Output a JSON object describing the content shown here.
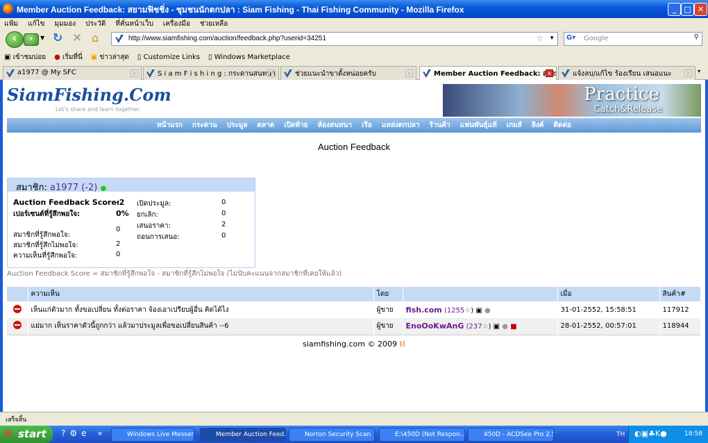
{
  "window": {
    "title": "Member Auction Feedback: สยามฟิชชิ่ง - ชุมชนนักตกปลา : Siam Fishing - Thai Fishing Community - Mozilla Firefox"
  },
  "menu": [
    "แฟ้ม",
    "แก้ไข",
    "มุมมอง",
    "ประวัติ",
    "ที่คั่นหน้าเว็บ",
    "เครื่องมือ",
    "ช่วยเหลือ"
  ],
  "nav": {
    "url": "http://www.siamfishing.com/auction/feedback.php?userid=34251",
    "search_placeholder": "Google"
  },
  "bookmarks": [
    "เข้าชมบ่อย",
    "เริ่มที่นี่",
    "ข่าวล่าสุด",
    "Customize Links",
    "Windows Marketplace"
  ],
  "tabs": [
    {
      "label": "a1977 @ My SFC"
    },
    {
      "label": "S i a m F i s h i n g : กระดานสนทนา"
    },
    {
      "label": "ช่วยแนะนำขาตั้งหน่อยครับ"
    },
    {
      "label": "Member Auction Feedback: สยาม..."
    },
    {
      "label": "แจ้งลบ/แก้ไข ร้องเรียน เสนอแนะ"
    }
  ],
  "site": {
    "logo": "SiamFishing.Com",
    "logo_tagline": "Let's share and learn together.",
    "banner_title": "Practice",
    "banner_sub": "Catch&Release",
    "nav": [
      "หน้าแรก",
      "กระดาน",
      "ประมูล",
      "ตลาด",
      "เปิดท้าย",
      "ห้องสนทนา",
      "เรือ",
      "แหล่งตกปลา",
      "ร้านค้า",
      "แฟนพันธุ์แท้",
      "เกมส์",
      "ลิงค์",
      "ติดต่อ"
    ]
  },
  "page": {
    "title": "Auction Feedback"
  },
  "member": {
    "label": "สมาชิก:",
    "name": "a1977",
    "score_paren": "(-2)",
    "score_label": "Auction Feedback Score:",
    "score": "-2",
    "percent_label": "เปอร์เซนต์ที่รู้สึกพอใจ:",
    "percent": "0%",
    "left_stats": [
      {
        "label": "สมาชิกที่รู้สึกพอใจ:",
        "value": "0"
      },
      {
        "label": "สมาชิกที่รู้สึกไม่พอใจ:",
        "value": "2"
      },
      {
        "label": "ความเห็นที่รู้สึกพอใจ:",
        "value": "0"
      }
    ],
    "right_stats": [
      {
        "label": "เปิดประมูล:",
        "value": "0"
      },
      {
        "label": "ยกเลิก:",
        "value": "0"
      },
      {
        "label": "เสนอราคา:",
        "value": "2"
      },
      {
        "label": "ถอนการเสนอ:",
        "value": "0"
      }
    ]
  },
  "formula": "Auction Feedback Score = สมาชิกที่รู้สึกพอใจ - สมาชิกที่รู้สึกไม่พอใจ (ไม่นับคะแนนจากสมาชิกที่เคยให้แล้ว)",
  "table": {
    "headers": [
      "ความเห็น",
      "โดย",
      "",
      "เมื่อ",
      "สินค้า#"
    ],
    "rows": [
      {
        "type": "negative",
        "comment": "เห็นแก่ตัวมาก ทั้งขอเปลี่ยน ทั้งต่อราคา จ้องเอาเปรียบผู้อื่น คิดได้ไง",
        "by": "ผู้ขาย",
        "user": "fish.com",
        "count": "(1255",
        "date": "31-01-2552, 15:58:51",
        "item": "117912"
      },
      {
        "type": "negative",
        "comment": "แย่มาก เห็นราคาตัวนี้ถูกกว่า แล้วมาประมูลเพื่อขอเปลี่ยนสินค้า --6",
        "by": "ผู้ขาย",
        "user": "EnoOoKwAnG",
        "count": "(237",
        "date": "28-01-2552, 00:57:01",
        "item": "118944"
      }
    ]
  },
  "footer": "siamfishing.com © 2009",
  "status": "เสร็จสิ้น",
  "taskbar": {
    "start": "start",
    "tasks": [
      "Windows Live Messen...",
      "Member Auction Feed...",
      "Norton Security Scan",
      "E:\\450D (Not Respon...",
      "450D - ACDSee Pro 2.5"
    ],
    "lang": "TH",
    "clock": "18:58"
  }
}
